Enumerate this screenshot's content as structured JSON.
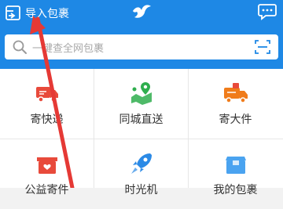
{
  "header": {
    "import_label": "导入包裹",
    "import_icon": "import-box-icon",
    "logo_icon": "bird-logo-icon",
    "message_icon": "chat-bubble-icon"
  },
  "search": {
    "placeholder": "一键查全网包裹",
    "search_icon": "search-icon",
    "scan_icon": "scan-icon"
  },
  "services": [
    {
      "label": "寄快递",
      "icon": "delivery-truck-icon",
      "color": "#e84a3b"
    },
    {
      "label": "同城直送",
      "icon": "map-pin-route-icon",
      "color": "#2fae4e"
    },
    {
      "label": "寄大件",
      "icon": "large-truck-icon",
      "color": "#f07c1b"
    },
    {
      "label": "公益寄件",
      "icon": "charity-box-icon",
      "color": "#e84a3b"
    },
    {
      "label": "时光机",
      "icon": "rocket-icon",
      "color": "#2b8ae6"
    },
    {
      "label": "我的包裹",
      "icon": "package-box-icon",
      "color": "#4aa3f0"
    }
  ],
  "annotation": {
    "color": "#e53935"
  }
}
